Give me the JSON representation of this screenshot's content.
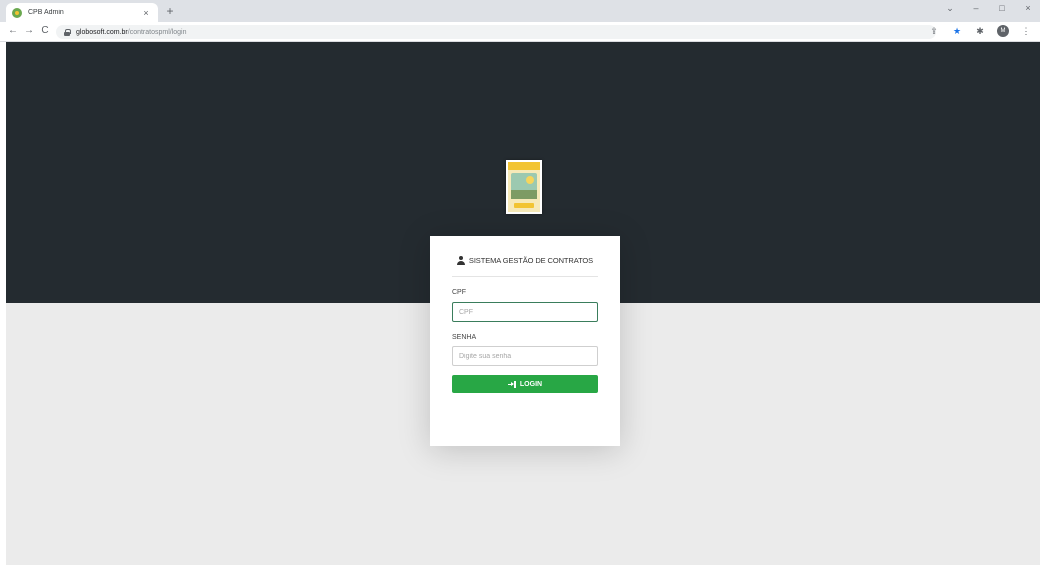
{
  "browser": {
    "tab_title": "CPB Admin",
    "tab_close": "×",
    "new_tab": "+",
    "url_host": "globosoft.com.br",
    "url_path": "/contratospml/login",
    "back": "←",
    "forward": "→",
    "reload": "C",
    "window": {
      "chevron": "⌄",
      "minimize": "–",
      "maximize": "□",
      "close": "×"
    },
    "icons": {
      "share": "⇪",
      "bookmark_star": "★",
      "extensions": "✱",
      "profile_initial": "M",
      "menu": "⋮"
    }
  },
  "login": {
    "header_icon": "user-icon",
    "title": "SISTEMA GESTÃO DE CONTRATOS",
    "cpf_label": "CPF",
    "cpf_placeholder": "CPF",
    "senha_label": "SENHA",
    "senha_placeholder": "Digite sua senha",
    "button_label": "LOGIN"
  },
  "colors": {
    "dark_band": "#242b30",
    "light_background": "#ebebeb",
    "button_green": "#28a745",
    "focus_border": "#3a7d5c"
  }
}
